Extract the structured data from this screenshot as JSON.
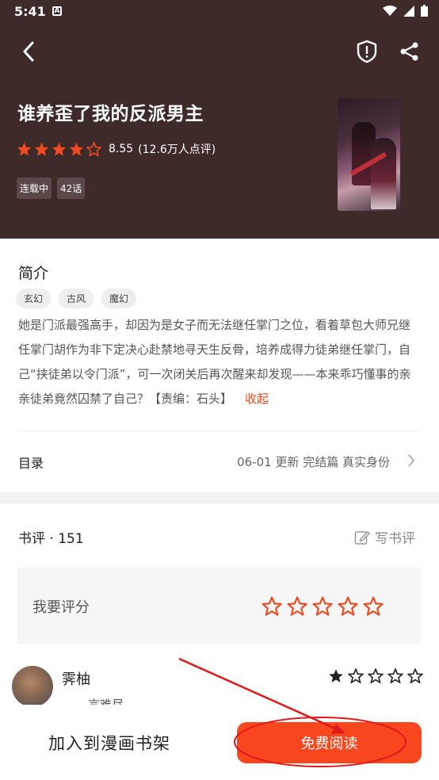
{
  "status": {
    "time": "5:41",
    "notif_letter": "A"
  },
  "header": {
    "title": "谁养歪了我的反派男主",
    "rating": {
      "score": "8.55",
      "count": "(12.6万人点评)",
      "stars": 4.5
    },
    "tags": [
      "连载中",
      "42话"
    ]
  },
  "intro": {
    "title": "简介",
    "genres": [
      "玄幻",
      "古风",
      "魔幻"
    ],
    "description": "她是门派最强高手，却因为是女子而无法继任掌门之位，看着草包大师兄继任掌门胡作为非下定决心赴禁地寻天生反骨，培养成得力徒弟继任掌门，自己“挟徒弟以令门派”，可一次闭关后再次醒来却发现——本来乖巧懂事的亲亲徒弟竟然囚禁了自己？【责编：石头】",
    "collapse_label": "收起"
  },
  "toc": {
    "label": "目录",
    "update": "06-01  更新  完结篇 真实身份"
  },
  "reviews": {
    "title": "书评 · 151",
    "write_label": "写书评",
    "rate_label": "我要评分",
    "items": [
      {
        "name": "霁柚",
        "badge": "—言难尽",
        "stars": 1
      }
    ]
  },
  "bottom": {
    "add_shelf_label": "加入到漫画书架",
    "read_label": "免费阅读"
  },
  "colors": {
    "header_bg": "#3e2a29",
    "accent": "#f8471f",
    "star": "#f04a23",
    "annotation": "#e0191b"
  }
}
